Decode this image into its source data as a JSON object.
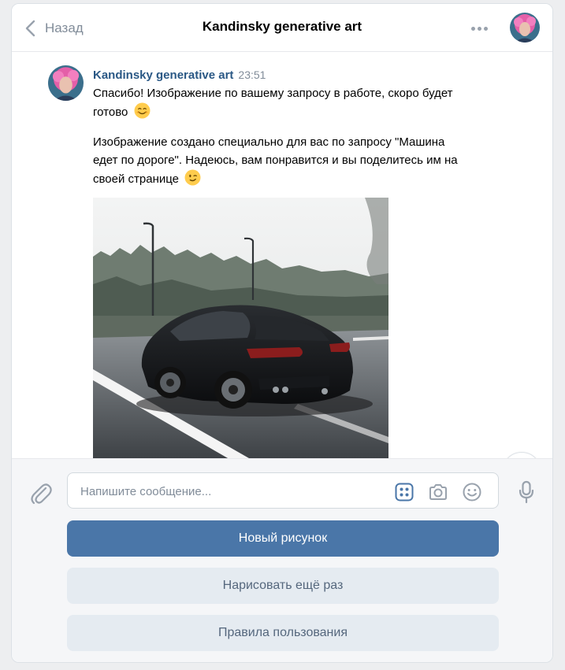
{
  "header": {
    "back_label": "Назад",
    "title": "Kandinsky generative art"
  },
  "message": {
    "author": "Kandinsky generative art",
    "time": "23:51",
    "text1": "Спасибо! Изображение по вашему запросу в работе, скоро будет готово",
    "text1_emoji": "smiling-face-emoji",
    "text2": "Изображение создано специально для вас по запросу \"Машина едет по дороге\". Надеюсь, вам понравится и вы поделитесь им на своей странице",
    "text2_emoji": "winking-face-emoji",
    "image": "black sports car on road photo"
  },
  "composer": {
    "placeholder": "Напишите сообщение...",
    "icons": [
      "paperclip-icon",
      "keyboard-grid-icon",
      "camera-icon",
      "smile-icon",
      "microphone-icon"
    ]
  },
  "keyboard": {
    "buttons": [
      "Новый рисунок",
      "Нарисовать ещё раз",
      "Правила пользования"
    ]
  },
  "colors": {
    "accent": "#4a76a8",
    "author_link": "#2a5885",
    "secondary_button": "#e5ebf1",
    "secondary_text": "#55677d",
    "muted": "#818c99"
  }
}
